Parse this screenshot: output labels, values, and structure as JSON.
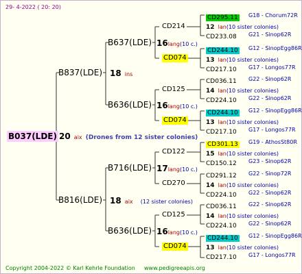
{
  "header": {
    "date": "29-  4-2022  ( 20: 20)"
  },
  "footer": {
    "copyright": "Copyright 2004-2022 © Karl Kehrle Foundation",
    "site": "www.pedigreeapis.org"
  },
  "root": {
    "name": "B037(LDE)",
    "num": "20",
    "loc": "aix",
    "note": "(Drones from 12 sister colonies)"
  },
  "g1": [
    {
      "name": "B837(LDE)",
      "num": "18",
      "loc": "ins",
      "note": ""
    },
    {
      "name": "B816(LDE)",
      "num": "18",
      "loc": "aix",
      "note": "(12 sister colonies)"
    }
  ],
  "g2": [
    {
      "name": "B637(LDE)",
      "num": "16",
      "loc": "lang",
      "note": "(10 c.)"
    },
    {
      "name": "B636(LDE)",
      "num": "16",
      "loc": "lang",
      "note": "(10 c.)"
    },
    {
      "name": "B716(LDE)",
      "num": "17",
      "loc": "lang",
      "note": "(10 c.)"
    },
    {
      "name": "B636(LDE)",
      "num": "16",
      "loc": "lang",
      "note": "(10 c.)"
    }
  ],
  "g3": [
    "CD214",
    "CD074",
    "CD125",
    "CD074",
    "CD122",
    "CD270",
    "CD125",
    "CD074"
  ],
  "g4": [
    {
      "top": "CD295.11",
      "toplab": "G18 - Chorum72R",
      "num": "12",
      "loc": "lan",
      "note": "(10 sister colonies)",
      "bot": "CD233.08",
      "botlab": "G21 - Sinop62R"
    },
    {
      "top": "CD244.10",
      "toplab": "G12 - SinopEgg86R",
      "num": "13",
      "loc": "lan",
      "note": "(10 sister colonies)",
      "bot": "CD217.10",
      "botlab": "G17 - Longos77R"
    },
    {
      "top": "CD036.11",
      "toplab": "G22 - Sinop62R",
      "num": "14",
      "loc": "lan",
      "note": "(10 sister colonies)",
      "bot": "CD224.10",
      "botlab": "G22 - Sinop62R"
    },
    {
      "top": "CD244.10",
      "toplab": "G12 - SinopEgg86R",
      "num": "13",
      "loc": "lan",
      "note": "(10 sister colonies)",
      "bot": "CD217.10",
      "botlab": "G17 - Longos77R"
    },
    {
      "top": "CD301.13",
      "toplab": "G19 - AthosSt80R",
      "num": "15",
      "loc": "lan",
      "note": "(10 sister colonies)",
      "bot": "CD150.12",
      "botlab": "G23 - Sinop62R"
    },
    {
      "top": "CD291.12",
      "toplab": "G22 - Sinop72R",
      "num": "14",
      "loc": "lan",
      "note": "(10 sister colonies)",
      "bot": "CD224.10",
      "botlab": "G22 - Sinop62R"
    },
    {
      "top": "CD036.11",
      "toplab": "G22 - Sinop62R",
      "num": "14",
      "loc": "lan",
      "note": "(10 sister colonies)",
      "bot": "CD224.10",
      "botlab": "G22 - Sinop62R"
    },
    {
      "top": "CD244.10",
      "toplab": "G12 - SinopEgg86R",
      "num": "13",
      "loc": "lan",
      "note": "(10 sister colonies)",
      "bot": "CD217.10",
      "botlab": "G17 - Longos77R"
    }
  ],
  "colors": {
    "root_bg": "#ffccff",
    "green": "#00cc00",
    "cyan": "#00cccc",
    "yellow": "#ffff00",
    "loc": "#aa0000",
    "label": "#0000aa"
  }
}
